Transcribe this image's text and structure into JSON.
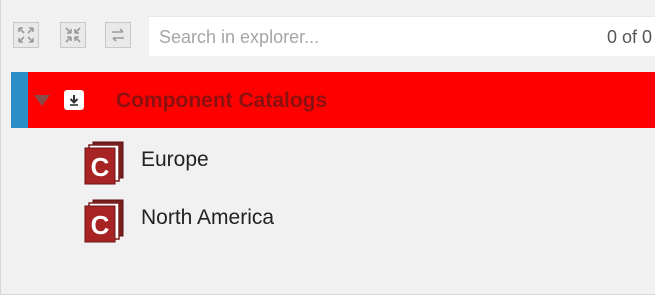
{
  "toolbar": {
    "buttons": [
      {
        "name": "expand-all",
        "icon": "expand-arrows-icon"
      },
      {
        "name": "collapse-all",
        "icon": "collapse-arrows-icon"
      },
      {
        "name": "sync",
        "icon": "sync-icon"
      }
    ]
  },
  "search": {
    "placeholder": "Search in explorer...",
    "count": "0 of 0"
  },
  "tree": {
    "root": {
      "label": "Component Catalogs",
      "icon": "download-icon",
      "expanded": true,
      "selected_color": "#ff0000",
      "label_color": "#8b1010",
      "accent_color": "#2a8fc6"
    },
    "children": [
      {
        "label": "Europe",
        "icon": "component-catalog-icon"
      },
      {
        "label": "North America",
        "icon": "component-catalog-icon"
      }
    ]
  }
}
